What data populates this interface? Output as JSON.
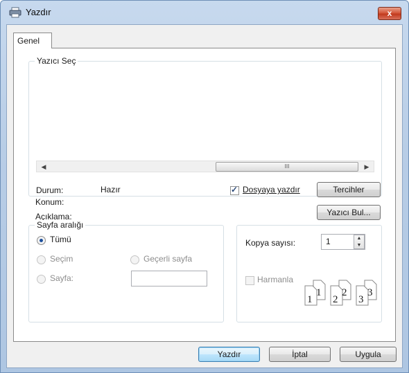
{
  "window": {
    "title": "Yazdır",
    "close_glyph": "x"
  },
  "tabs": [
    {
      "label": "Genel"
    }
  ],
  "printer_group": {
    "legend": "Yazıcı Seç",
    "scroll_thumb_glyph": "III",
    "status_label": "Durum:",
    "status_value": "Hazır",
    "location_label": "Konum:",
    "comment_label": "Açıklama:",
    "print_to_file_label": "Dosyaya yazdır",
    "print_to_file_checked": true,
    "preferences_button": "Tercihler",
    "find_printer_button": "Yazıcı Bul..."
  },
  "page_range": {
    "legend": "Sayfa aralığı",
    "all_label": "Tümü",
    "selection_label": "Seçim",
    "current_page_label": "Geçerli sayfa",
    "pages_label": "Sayfa:",
    "pages_value": ""
  },
  "copies": {
    "copies_label": "Kopya sayısı:",
    "copies_value": "1",
    "collate_label": "Harmanla",
    "collate_checked": false,
    "page_icons": [
      "1",
      "1",
      "2",
      "2",
      "3",
      "3"
    ]
  },
  "footer": {
    "print_button": "Yazdır",
    "cancel_button": "İptal",
    "apply_button": "Uygula"
  },
  "colors": {
    "titlebar": "#b8cde6",
    "close": "#c23a1e",
    "default_button": "#3c7fb1"
  },
  "icons": {
    "title": "printer-icon",
    "close": "close-icon"
  }
}
